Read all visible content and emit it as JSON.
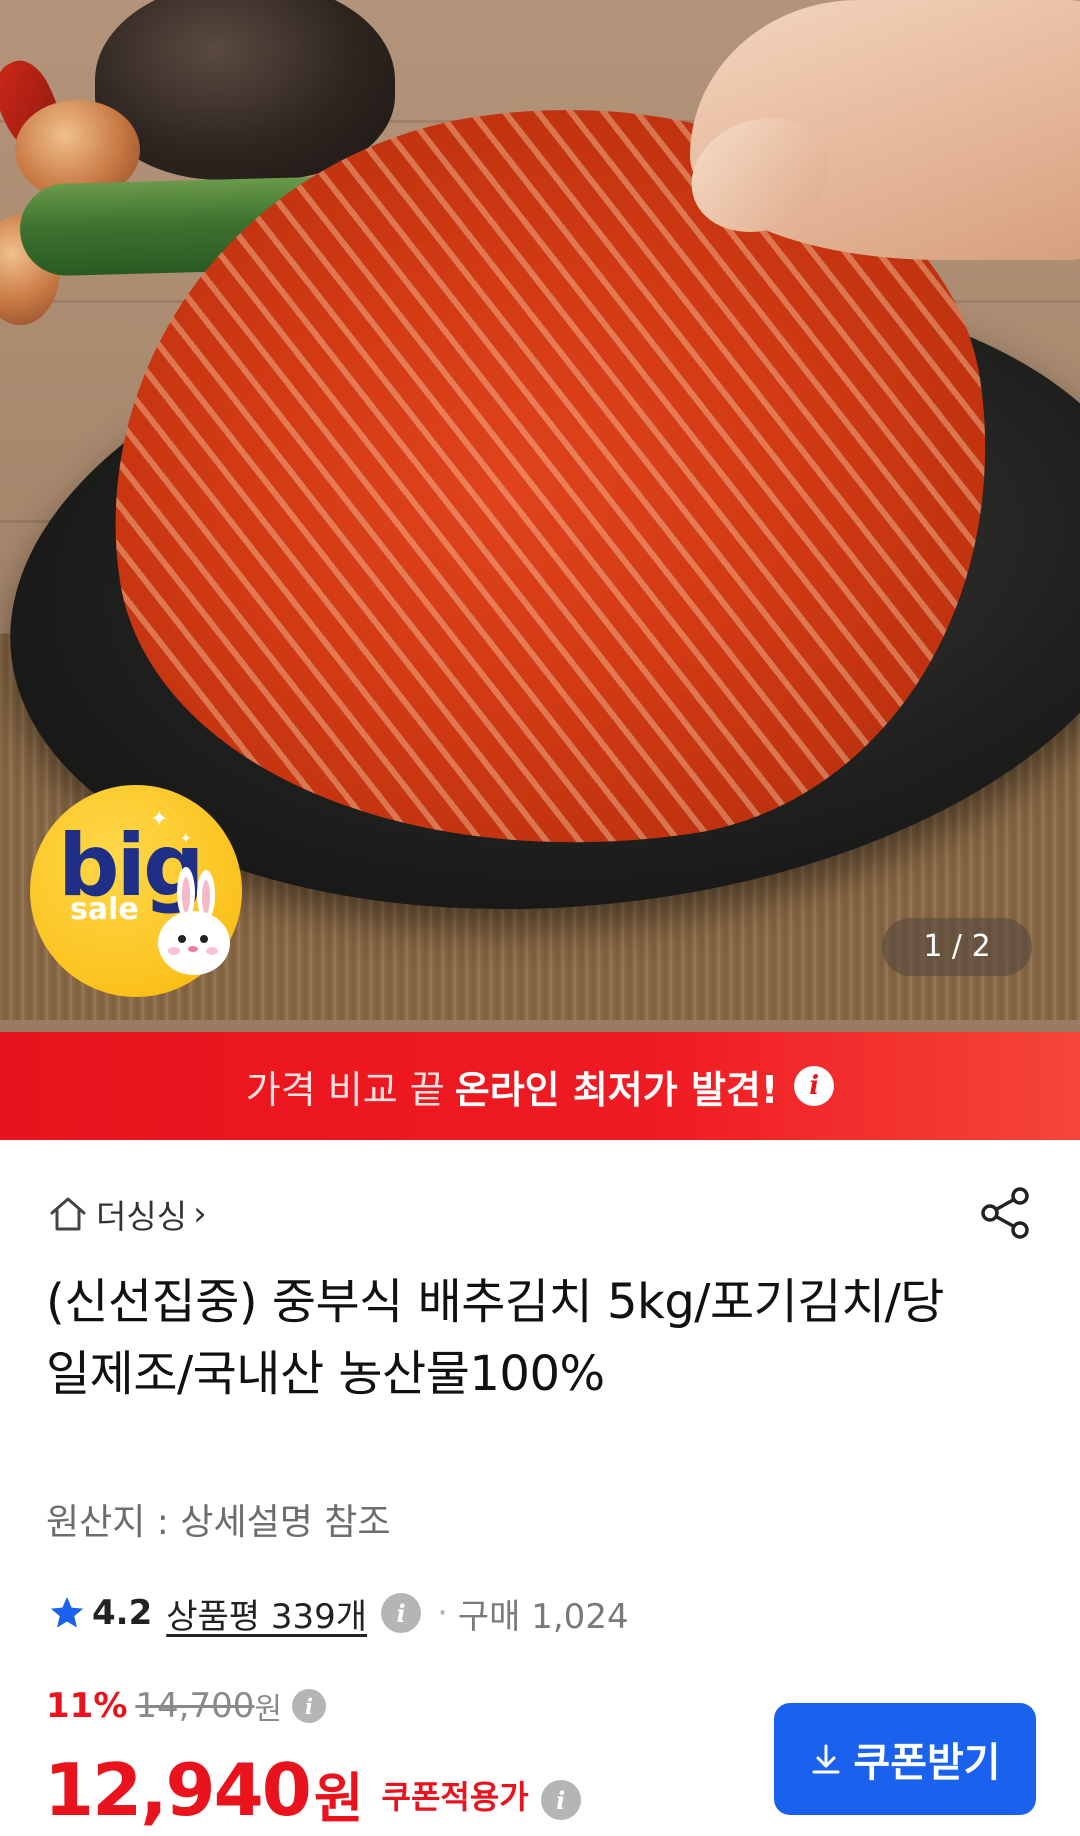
{
  "gallery": {
    "badge_big": "big",
    "badge_sale": "sale",
    "counter": "1 / 2"
  },
  "banner": {
    "text_regular": "가격 비교 끝",
    "text_strong": "온라인 최저가 발견!",
    "info_icon": "i"
  },
  "store": {
    "name": "더싱싱",
    "chevron": "›",
    "home_icon": "home-outline-icon",
    "share_icon": "share-icon"
  },
  "product": {
    "title": "(신선집중) 중부식 배추김치 5kg/포기김치/당일제조/국내산 농산물100%",
    "origin": "원산지 : 상세설명 참조"
  },
  "rating": {
    "score": "4.2",
    "reviews": "상품평 339개",
    "separator": "·",
    "purchases": "구매 1,024"
  },
  "price": {
    "discount": "11%",
    "original": "14,700",
    "original_unit": "원",
    "current": "12,940",
    "current_unit": "원",
    "coupon_label": "쿠폰적용가"
  },
  "coupon_button": {
    "label": "쿠폰받기",
    "icon": "download-arrow-icon"
  },
  "colors": {
    "accent_red": "#e8131c",
    "button_blue": "#1a62ee",
    "star_blue": "#1a62ee",
    "badge_yellow": "#fbc21d"
  }
}
